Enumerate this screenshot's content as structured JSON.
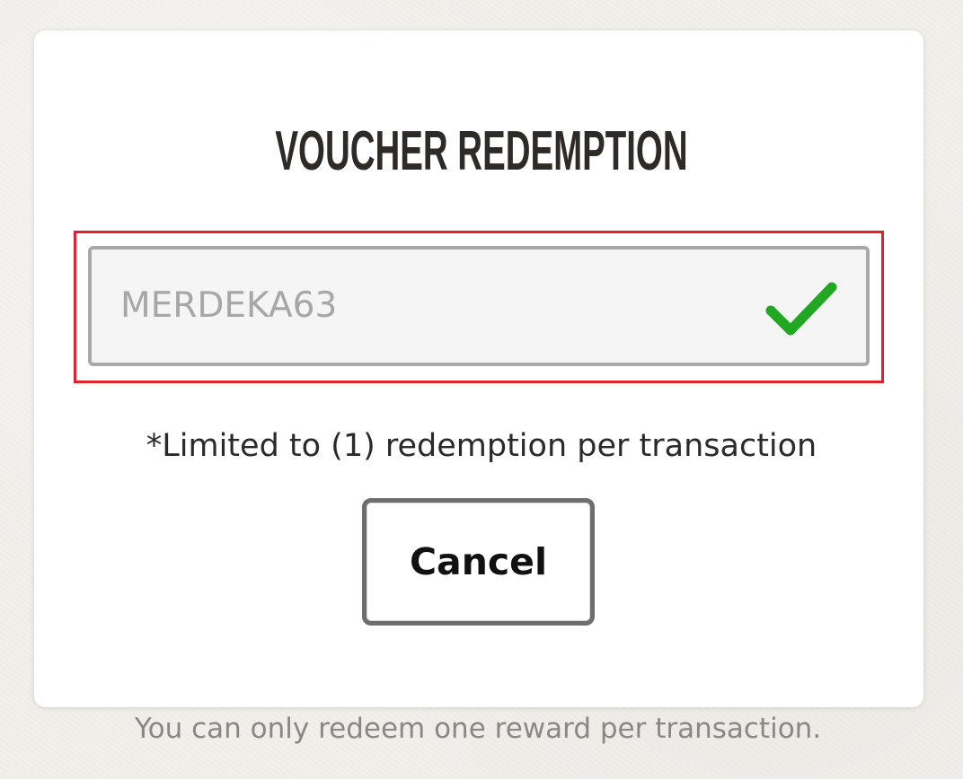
{
  "dialog": {
    "title": "VOUCHER REDEMPTION",
    "voucher_field": {
      "value": "MERDEKA63",
      "status_icon": "check-icon",
      "status_color": "#22a722",
      "highlight_color": "#e3202b"
    },
    "limit_note": "*Limited to (1) redemption per transaction",
    "cancel_label": "Cancel"
  },
  "footer": {
    "note": "You can only redeem one reward per transaction."
  }
}
